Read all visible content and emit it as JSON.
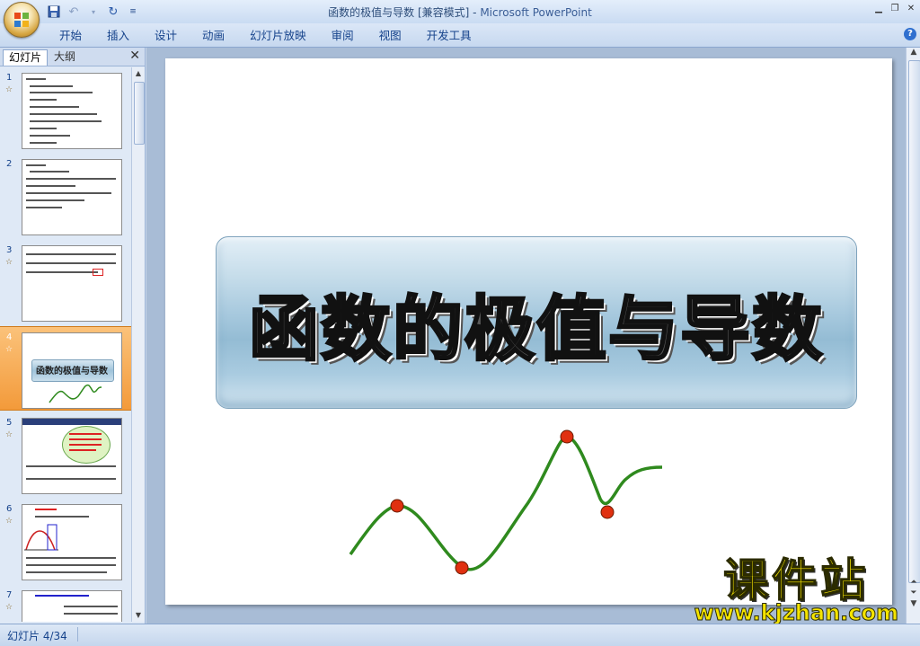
{
  "window": {
    "title": "函数的极值与导数 [兼容模式]",
    "app_name": "Microsoft PowerPoint"
  },
  "ribbon": {
    "tabs": [
      "开始",
      "插入",
      "设计",
      "动画",
      "幻灯片放映",
      "审阅",
      "视图",
      "开发工具"
    ]
  },
  "pane": {
    "tab_slides": "幻灯片",
    "tab_outline": "大纲",
    "slide_numbers": [
      "1",
      "2",
      "3",
      "4",
      "5",
      "6",
      "7"
    ],
    "selected_index": 4,
    "thumb4_title": "函数的极值与导数"
  },
  "slide": {
    "title": "函数的极值与导数"
  },
  "watermark": {
    "chinese": "课件站",
    "url": "www.kjzhan.com"
  },
  "status": {
    "slide_indicator": "幻灯片 4/34"
  },
  "colors": {
    "curve": "#2f8a1e",
    "point": "#e03010",
    "selection": "#f7a64a"
  }
}
